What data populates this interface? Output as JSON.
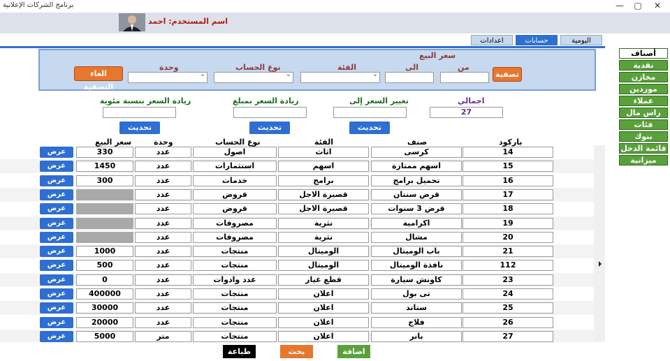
{
  "window": {
    "title": "برنامج الشركات الإعلانية",
    "minimize": "—",
    "maximize": "▢",
    "close": "✕"
  },
  "user": {
    "label": "اسم المستخدم: احمد"
  },
  "tabs": [
    {
      "label": "اليومية"
    },
    {
      "label": "حسابات"
    },
    {
      "label": "اعدادات"
    }
  ],
  "sidebar": {
    "items": [
      {
        "label": "أصناف"
      },
      {
        "label": "نقدية"
      },
      {
        "label": "مخازن"
      },
      {
        "label": "موردين"
      },
      {
        "label": "عملاء"
      },
      {
        "label": "راس مال"
      },
      {
        "label": "فئات"
      },
      {
        "label": "بنوك"
      },
      {
        "label": "قائمة الدخل"
      },
      {
        "label": "ميزانية"
      }
    ]
  },
  "filter": {
    "price_label": "سعر البيع",
    "from_label": "من",
    "to_label": "الى",
    "category_label": "الفئة",
    "account_type_label": "نوع الحساب",
    "unit_label": "وحدة",
    "filter_button": "تصفية",
    "cancel_filter_button": "الغاء التصفية"
  },
  "update": {
    "total_label": "اجمالي",
    "total_value": "27",
    "change_to_label": "تغيير السعر إلى",
    "increase_amount_label": "زيادة السعر بمبلغ",
    "increase_percent_label": "زيادة السعر بنسبة مئوية",
    "update_button": "تحديث"
  },
  "table": {
    "headers": {
      "barcode": "باركود",
      "item": "صنف",
      "category": "الفئة",
      "account_type": "نوع الحساب",
      "unit": "وحدة",
      "price": "سعر البيع"
    },
    "view_label": "عرض",
    "rows": [
      {
        "barcode": "14",
        "item": "كرسى",
        "category": "اثاث",
        "account": "اصول",
        "unit": "عدد",
        "price": "330"
      },
      {
        "barcode": "15",
        "item": "اسهم ممتازة",
        "category": "اسهم",
        "account": "استثمارات",
        "unit": "عدد",
        "price": "1450"
      },
      {
        "barcode": "16",
        "item": "تحميل برامج",
        "category": "برامج",
        "account": "خدمات",
        "unit": "عدد",
        "price": "300"
      },
      {
        "barcode": "17",
        "item": "قرض سنتان",
        "category": "قصيرة الاجل",
        "account": "قروض",
        "unit": "عدد",
        "price": ""
      },
      {
        "barcode": "18",
        "item": "قرض 3 سنوات",
        "category": "قصيرة الاجل",
        "account": "قروض",
        "unit": "عدد",
        "price": ""
      },
      {
        "barcode": "19",
        "item": "اكرامية",
        "category": "نثرية",
        "account": "مصروفات",
        "unit": "عدد",
        "price": ""
      },
      {
        "barcode": "20",
        "item": "مشال",
        "category": "نثرية",
        "account": "مصروفات",
        "unit": "عدد",
        "price": ""
      },
      {
        "barcode": "21",
        "item": "باب الوميتال",
        "category": "الوميتال",
        "account": "منتجات",
        "unit": "عدد",
        "price": "1000"
      },
      {
        "barcode": "112",
        "item": "نافذة الوميتال",
        "category": "الوميتال",
        "account": "منتجات",
        "unit": "عدد",
        "price": "500"
      },
      {
        "barcode": "23",
        "item": "كاوتش سيارة",
        "category": "قطع غيار",
        "account": "عدد وادوات",
        "unit": "عدد",
        "price": "0"
      },
      {
        "barcode": "24",
        "item": "تى بول",
        "category": "اعلان",
        "account": "منتجات",
        "unit": "عدد",
        "price": "400000"
      },
      {
        "barcode": "25",
        "item": "ستاند",
        "category": "اعلان",
        "account": "منتجات",
        "unit": "عدد",
        "price": "30000"
      },
      {
        "barcode": "26",
        "item": "فلاج",
        "category": "اعلان",
        "account": "منتجات",
        "unit": "عدد",
        "price": "20000"
      },
      {
        "barcode": "27",
        "item": "بانر",
        "category": "اعلان",
        "account": "منتجات",
        "unit": "متر",
        "price": "5000"
      }
    ]
  },
  "footer": {
    "add": "اضافة",
    "search": "بحث",
    "print": "طباعة"
  }
}
